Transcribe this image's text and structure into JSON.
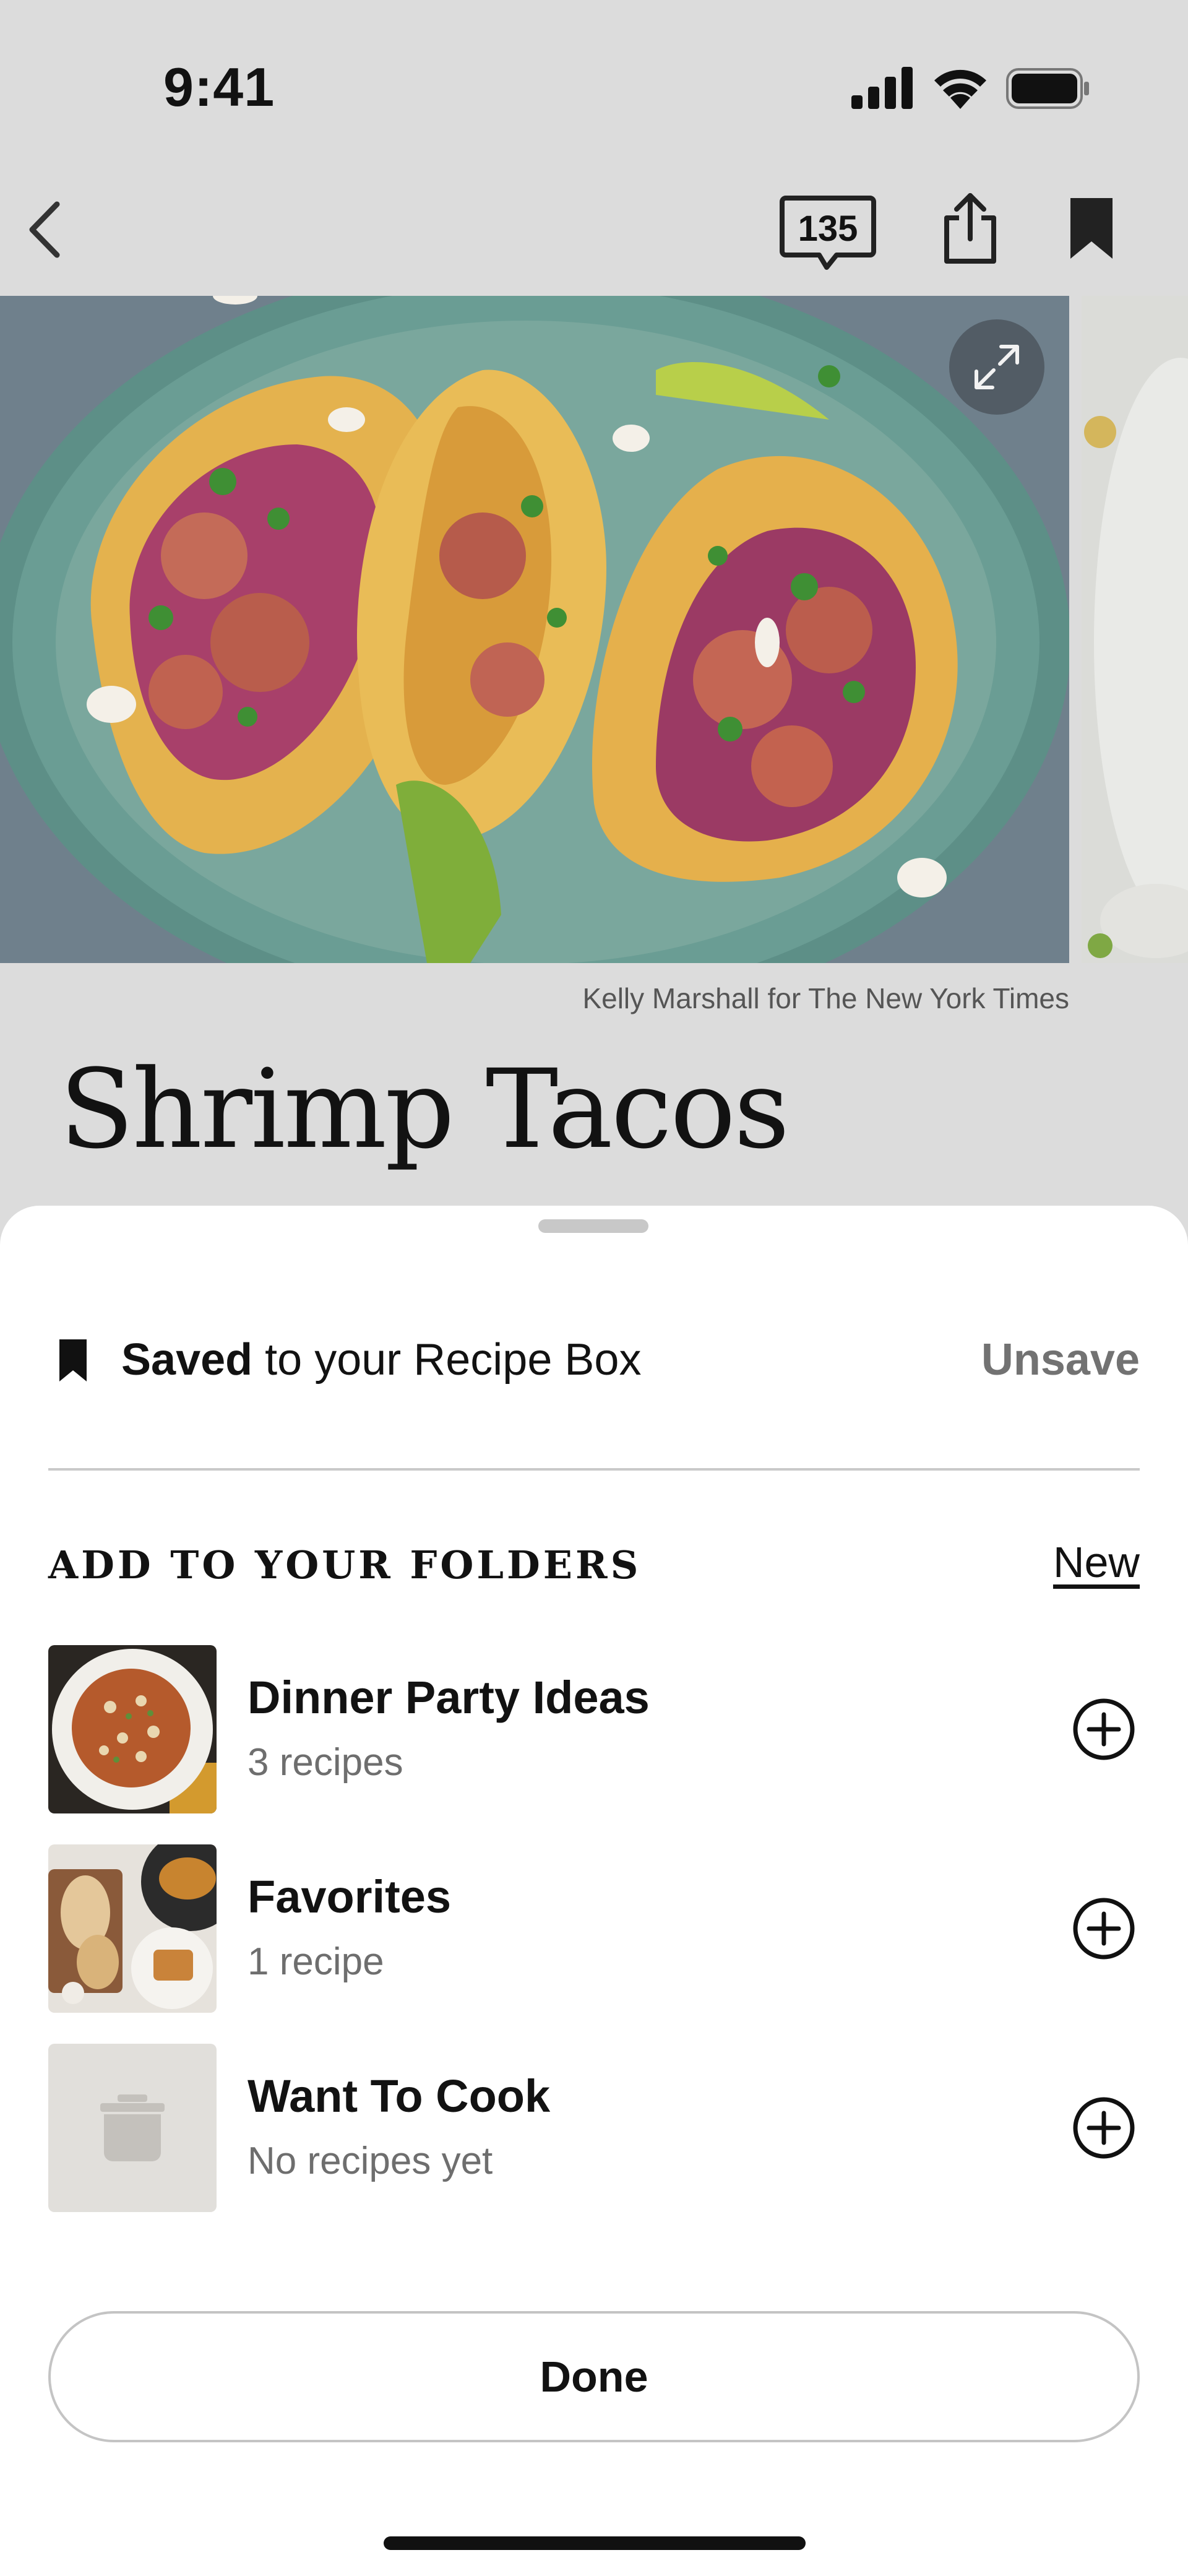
{
  "status_bar": {
    "time": "9:41"
  },
  "nav": {
    "comment_count": "135"
  },
  "recipe": {
    "photo_credit": "Kelly Marshall for The New York Times",
    "title": "Shrimp Tacos"
  },
  "sheet": {
    "saved_bold": "Saved",
    "saved_rest": " to your Recipe Box",
    "unsave_label": "Unsave",
    "folders_heading": "ADD TO YOUR FOLDERS",
    "new_label": "New",
    "folders": [
      {
        "name": "Dinner Party Ideas",
        "count": "3 recipes"
      },
      {
        "name": "Favorites",
        "count": "1 recipe"
      },
      {
        "name": "Want To Cook",
        "count": "No recipes yet"
      }
    ],
    "done_label": "Done"
  },
  "colors": {
    "background": "#dcdcdc",
    "sheet": "#ffffff",
    "text": "#121212",
    "muted": "#727272"
  },
  "icons": [
    "back-icon",
    "comment-icon",
    "share-icon",
    "bookmark-icon",
    "expand-icon",
    "add-circle-icon",
    "pot-icon"
  ]
}
